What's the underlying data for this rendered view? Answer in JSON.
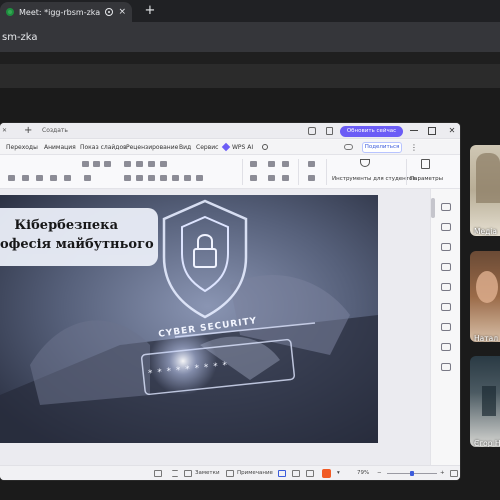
{
  "browser": {
    "tab_title": "Meet: *igg-rbsm-zka*",
    "url": "sm-zka",
    "new_tab": "+",
    "tab_close": "×"
  },
  "app": {
    "new_tab_label": "Создать",
    "update_button": "Обновить сейчас",
    "share_button": "Поделиться",
    "menu": [
      "Переходы",
      "Анимация",
      "Показ слайдов",
      "Рецензирование",
      "Вид",
      "Сервис",
      "WPS AI"
    ],
    "ribbon_students": "Инструменты для студентов",
    "ribbon_params": "Параметры",
    "status": {
      "notes": "Заметки",
      "comment": "Примечание",
      "zoom": "79%"
    }
  },
  "slide": {
    "title_line1": "Кібербезпека",
    "title_line2": "офесія майбутнього",
    "overlay_text": "CYBER SECURITY",
    "password_mask": "* * * * * * * * *"
  },
  "participants": [
    {
      "name": "Медіа"
    },
    {
      "name": "Натал"
    },
    {
      "name": "Єгор Н"
    }
  ],
  "colors": {
    "accent": "#6b5cf6",
    "slide_bg": "#5a6278"
  }
}
